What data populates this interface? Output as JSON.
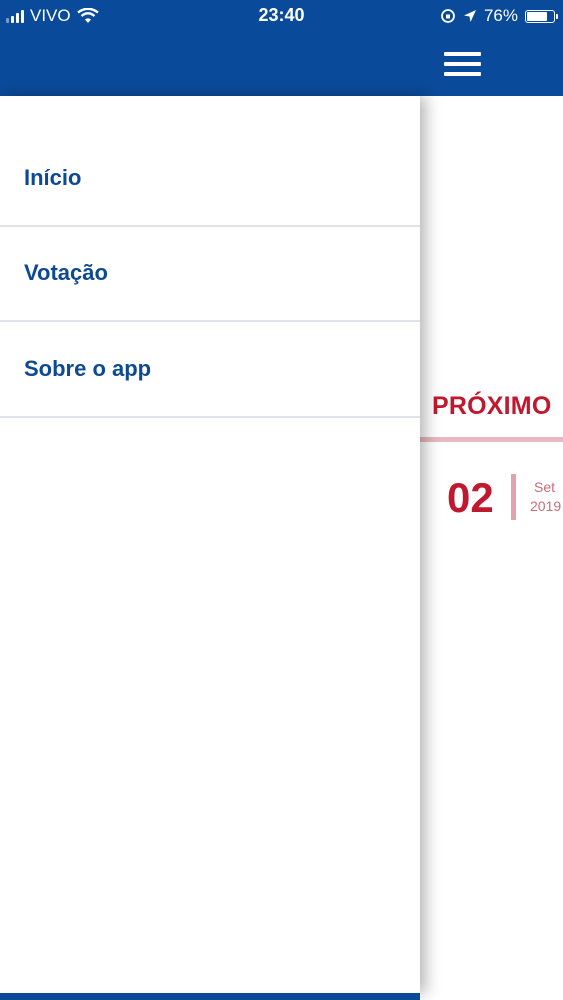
{
  "status_bar": {
    "carrier": "VIVO",
    "time": "23:40",
    "battery": "76%",
    "icons": [
      "signal-icon",
      "wifi-icon",
      "orientation-lock-icon",
      "location-icon",
      "battery-icon"
    ]
  },
  "drawer": {
    "items": [
      {
        "label": "Início"
      },
      {
        "label": "Votação"
      },
      {
        "label": "Sobre o app"
      }
    ]
  },
  "main": {
    "section_title": "PRÓXIMO",
    "date": {
      "day": "02",
      "month": "Set",
      "year": "2019"
    }
  },
  "colors": {
    "header_blue": "#0a4a9a",
    "menu_text_blue": "#0d4a93",
    "accent_red": "#c0182e",
    "accent_pink": "#e8b9c0"
  }
}
